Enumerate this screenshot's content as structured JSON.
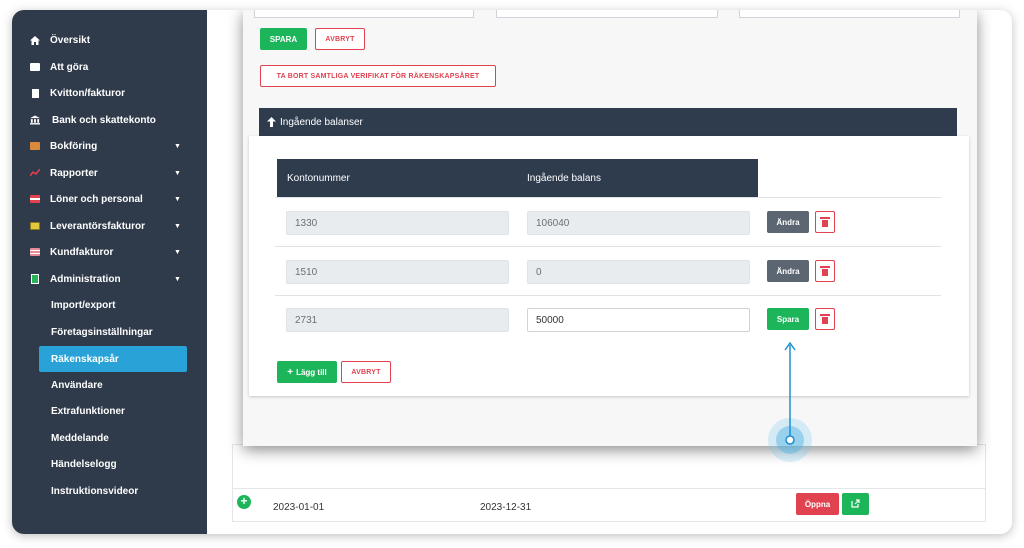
{
  "sidebar": {
    "items": [
      {
        "label": "Översikt",
        "icon": "home-icon",
        "caret": false
      },
      {
        "label": "Att göra",
        "icon": "list-icon",
        "caret": false
      },
      {
        "label": "Kvitton/fakturor",
        "icon": "receipt-icon",
        "caret": false
      },
      {
        "label": "Bank och skattekonto",
        "icon": "bank-icon",
        "caret": false
      },
      {
        "label": "Bokföring",
        "icon": "ledger-icon",
        "caret": true
      },
      {
        "label": "Rapporter",
        "icon": "chart-icon",
        "caret": true
      },
      {
        "label": "Löner och personal",
        "icon": "card-icon",
        "caret": true
      },
      {
        "label": "Leverantörsfakturor",
        "icon": "invoice-icon",
        "caret": true
      },
      {
        "label": "Kundfakturor",
        "icon": "customer-invoice-icon",
        "caret": true
      },
      {
        "label": "Administration",
        "icon": "admin-icon",
        "caret": true
      }
    ],
    "sub_items": [
      {
        "label": "Import/export"
      },
      {
        "label": "Företagsinställningar"
      },
      {
        "label": "Räkenskapsår",
        "active": true
      },
      {
        "label": "Användare"
      },
      {
        "label": "Extrafunktioner"
      },
      {
        "label": "Meddelande"
      },
      {
        "label": "Händelselogg"
      },
      {
        "label": "Instruktionsvideor"
      }
    ],
    "caret_glyph": "▼"
  },
  "modal": {
    "save_label": "SPARA",
    "cancel_label": "AVBRYT",
    "delete_all_label": "TA BORT SAMTLIGA VERIFIKAT FÖR RÄKENSKAPSÅRET",
    "panel_title": "Ingående balanser",
    "columns": [
      "Kontonummer",
      "Ingående balans"
    ],
    "rows": [
      {
        "account": "1330",
        "balance": "106040",
        "action": "Ändra"
      },
      {
        "account": "1510",
        "balance": "0",
        "action": "Ändra"
      },
      {
        "account": "2731",
        "balance": "50000",
        "action": "Spara"
      }
    ],
    "add_label": "Lägg till",
    "add_cancel_label": "AVBRYT"
  },
  "fiscal_year": {
    "start": "2023-01-01",
    "end": "2023-12-31",
    "open_label": "Öppna"
  },
  "colors": {
    "sidebar_bg": "#2f3a4a",
    "active": "#29a3d7",
    "green": "#1cb55a",
    "red": "#e0424f",
    "header": "#2f3c4e"
  }
}
